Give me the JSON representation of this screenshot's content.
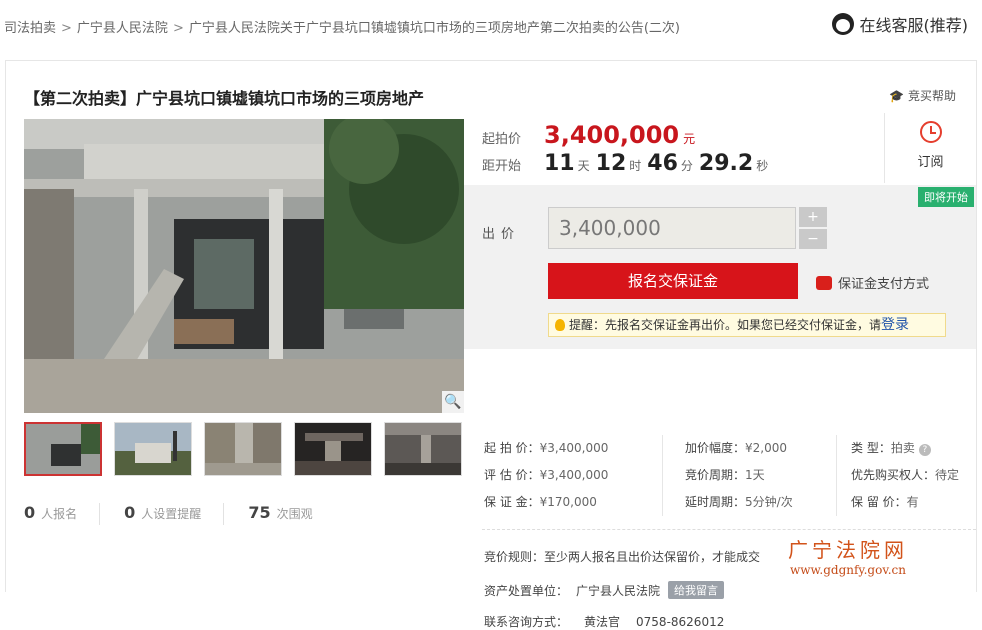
{
  "breadcrumb": [
    "司法拍卖",
    "广宁县人民法院",
    "广宁县人民法院关于广宁县坑口镇墟镇坑口市场的三项房地产第二次拍卖的公告(二次)"
  ],
  "breadcrumb_sep": ">",
  "service_label": "在线客服(推荐)",
  "title": "【第二次拍卖】广宁县坑口镇墟镇坑口市场的三项房地产",
  "help_label": "竞买帮助",
  "start_price_label": "起拍价",
  "start_price": "3,400,000",
  "start_price_unit": "元",
  "countdown_label": "距开始",
  "countdown": {
    "days": "11",
    "days_u": "天",
    "hours": "12",
    "hours_u": "时",
    "minutes": "46",
    "minutes_u": "分",
    "seconds": "29.2",
    "seconds_u": "秒"
  },
  "subscribe_label": "订阅",
  "status_badge": "即将开始",
  "bid_label": "出价",
  "bid_value": "3,400,000",
  "stepper": {
    "plus": "+",
    "minus": "−"
  },
  "signup_button": "报名交保证金",
  "pay_mode": "保证金支付方式",
  "tip": {
    "prefix": "提醒：",
    "text": "先报名交保证金再出价。如果您已经交付保证金，请",
    "login": "登录"
  },
  "details": {
    "col1": [
      {
        "k": "起 拍 价：",
        "v": "¥3,400,000"
      },
      {
        "k": "评 估 价：",
        "v": "¥3,400,000"
      },
      {
        "k": "保 证 金：",
        "v": "¥170,000"
      }
    ],
    "col2": [
      {
        "k": "加价幅度：",
        "v": "¥2,000"
      },
      {
        "k": "竞价周期：",
        "v": "1天"
      },
      {
        "k": "延时周期：",
        "v": "5分钟/次"
      }
    ],
    "col3": [
      {
        "k": "类    型：",
        "v": "拍卖"
      },
      {
        "k": "优先购买权人：",
        "v": "待定"
      },
      {
        "k": "保 留 价：",
        "v": "有"
      }
    ]
  },
  "rule_label": "竞价规则：",
  "rule_text": "至少两人报名且出价达保留价，才能成交",
  "owner_label": "资产处置单位：",
  "owner_name": "广宁县人民法院",
  "leave_msg": "给我留言",
  "contact_label": "联系咨询方式：",
  "contact_name": "黄法官",
  "contact_phone": "0758-8626012",
  "stats": [
    {
      "num": "0",
      "label": "人报名"
    },
    {
      "num": "0",
      "label": "人设置提醒"
    },
    {
      "num": "75",
      "label": "次围观"
    }
  ],
  "watermark": {
    "name": "广宁法院网",
    "url": "www.gdgnfy.gov.cn"
  },
  "colors": {
    "accent": "#c8161d",
    "button": "#d7141a",
    "badge": "#2ab06f"
  }
}
